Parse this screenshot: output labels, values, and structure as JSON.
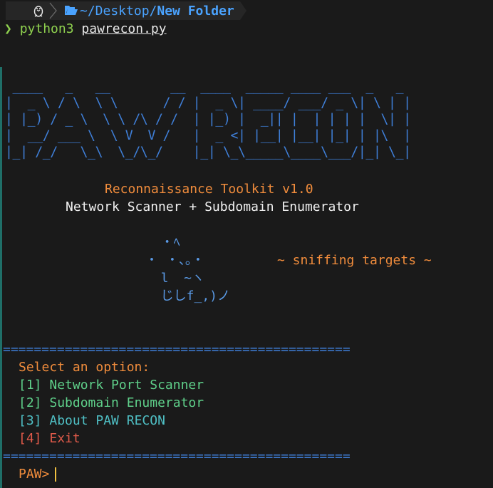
{
  "prompt": {
    "os_icon": "linux-tux-icon",
    "folder_icon": "folder-open-icon",
    "path_prefix": "~/Desktop/",
    "path_current": "New Folder",
    "prompt_symbol": "❯",
    "command": "python3",
    "argument": "pawrecon.py"
  },
  "banner": {
    "ascii_art": " ____   _   __        __  ____  _____ ____ ___  _   _ \n|  _ \\ / \\  \\ \\      / / |  _ \\| ____/ ___/ _ \\| \\ | |\n| |_) / _ \\  \\ \\ /\\ / /  | |_) |  _|| |  | | | |  \\| |\n|  __/ ___ \\  \\ V  V /   |  _ <| |__| |__| |_| | |\\  |\n|_| /_/   \\_\\  \\_/\\_/    |_| \\_\\_____\\____\\___/|_| \\_|",
    "title": "Reconnaissance Toolkit v1.0",
    "subtitle": "Network Scanner + Subdomain Enumerator"
  },
  "mascot": {
    "line1": "  ・ﾍ",
    "line2": "・ ・、。・",
    "line3": "  l  ~ヽ",
    "line4": "  じしf_,)ノ",
    "tagline": "~ sniffing targets ~"
  },
  "menu": {
    "separator": "=============================================",
    "heading": "Select an option:",
    "options": [
      {
        "key": "[1]",
        "label": "Network Port Scanner"
      },
      {
        "key": "[2]",
        "label": "Subdomain Enumerator"
      },
      {
        "key": "[3]",
        "label": "About PAW RECON"
      },
      {
        "key": "[4]",
        "label": "Exit"
      }
    ],
    "input_prompt": "PAW>"
  },
  "colors": {
    "background": "#1a1a1a",
    "ascii": "#3f7fd8",
    "title": "#f08c3c",
    "option_green": "#5fd08a",
    "option_cyan": "#4fbfc4",
    "option_red": "#e05a4a",
    "path_blue": "#4aa3ff"
  }
}
